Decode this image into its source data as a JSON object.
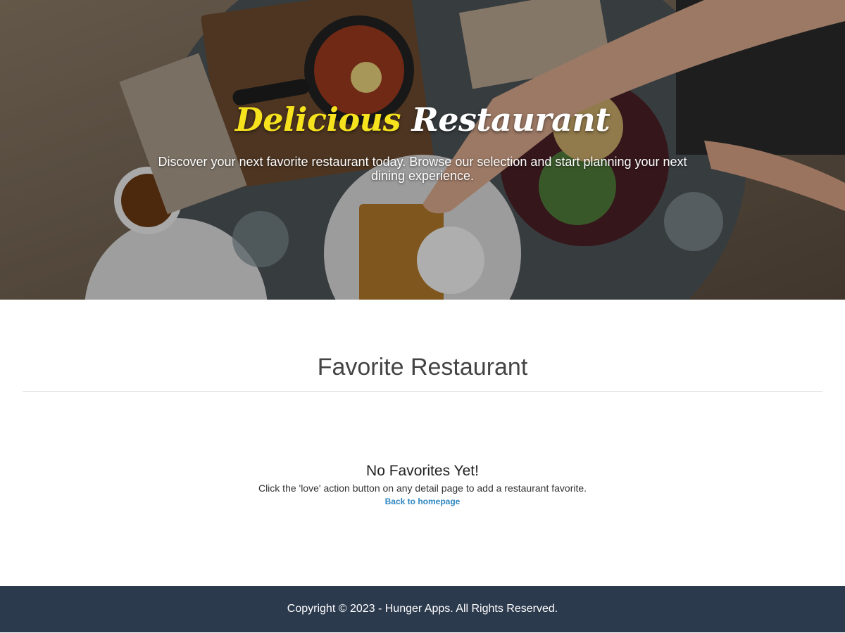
{
  "hero": {
    "title_accent": "Delicious",
    "title_rest": "Restaurant",
    "tagline": "Discover your next favorite restaurant today. Browse our selection and start planning your next dining experience."
  },
  "main": {
    "section_title": "Favorite Restaurant",
    "empty": {
      "title": "No Favorites Yet!",
      "description": "Click the 'love' action button on any detail page to add a restaurant favorite.",
      "link": "Back to homepage"
    }
  },
  "footer": {
    "text": "Copyright © 2023 - Hunger Apps. All Rights Reserved."
  },
  "colors": {
    "title_accent": "#f7e21e",
    "link": "#2e86c1",
    "footer_bg": "#2c3a4e"
  }
}
